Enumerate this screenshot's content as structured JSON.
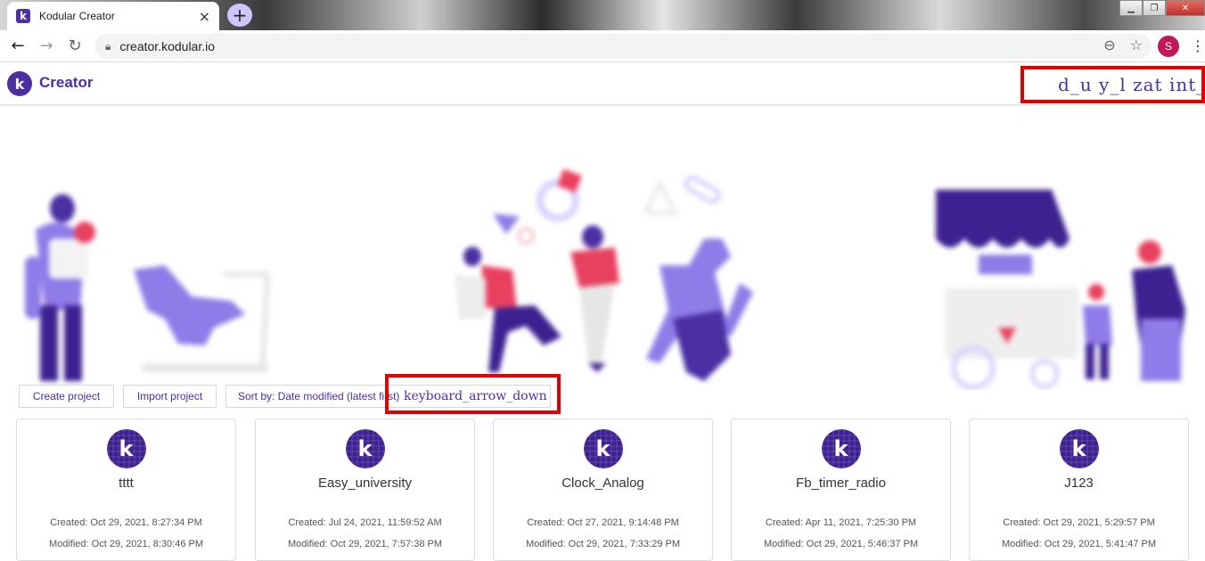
{
  "browser": {
    "tab_title": "Kodular Creator",
    "tab_favicon": "k",
    "tab_close": "×",
    "new_tab": "+",
    "url": "creator.kodular.io",
    "profile_initial": "S",
    "window_controls": {
      "minimize": "▁",
      "restore": "❐",
      "close": "✕"
    }
  },
  "app": {
    "logo_letter": "k",
    "title": "Creator",
    "account_text": "d_u   y_l   zat   int_",
    "brand_color": "#4b2fa3"
  },
  "toolbar": {
    "create_project": "Create project",
    "import_project": "Import project",
    "sort_by": "Sort by: Date modified (latest first)",
    "sort_arrow": "keyboard_arrow_down"
  },
  "projects": [
    {
      "name": "tttt",
      "created": "Created: Oct 29, 2021, 8:27:34 PM",
      "modified": "Modified: Oct 29, 2021, 8:30:46 PM"
    },
    {
      "name": "Easy_university",
      "created": "Created: Jul 24, 2021, 11:59:52 AM",
      "modified": "Modified: Oct 29, 2021, 7:57:38 PM"
    },
    {
      "name": "Clock_Analog",
      "created": "Created: Oct 27, 2021, 9:14:48 PM",
      "modified": "Modified: Oct 29, 2021, 7:33:29 PM"
    },
    {
      "name": "Fb_timer_radio",
      "created": "Created: Apr 11, 2021, 7:25:30 PM",
      "modified": "Modified: Oct 29, 2021, 5:46:37 PM"
    },
    {
      "name": "J123",
      "created": "Created: Oct 29, 2021, 5:29:57 PM",
      "modified": "Modified: Oct 29, 2021, 5:41:47 PM"
    }
  ],
  "project_icon_letter": "k"
}
